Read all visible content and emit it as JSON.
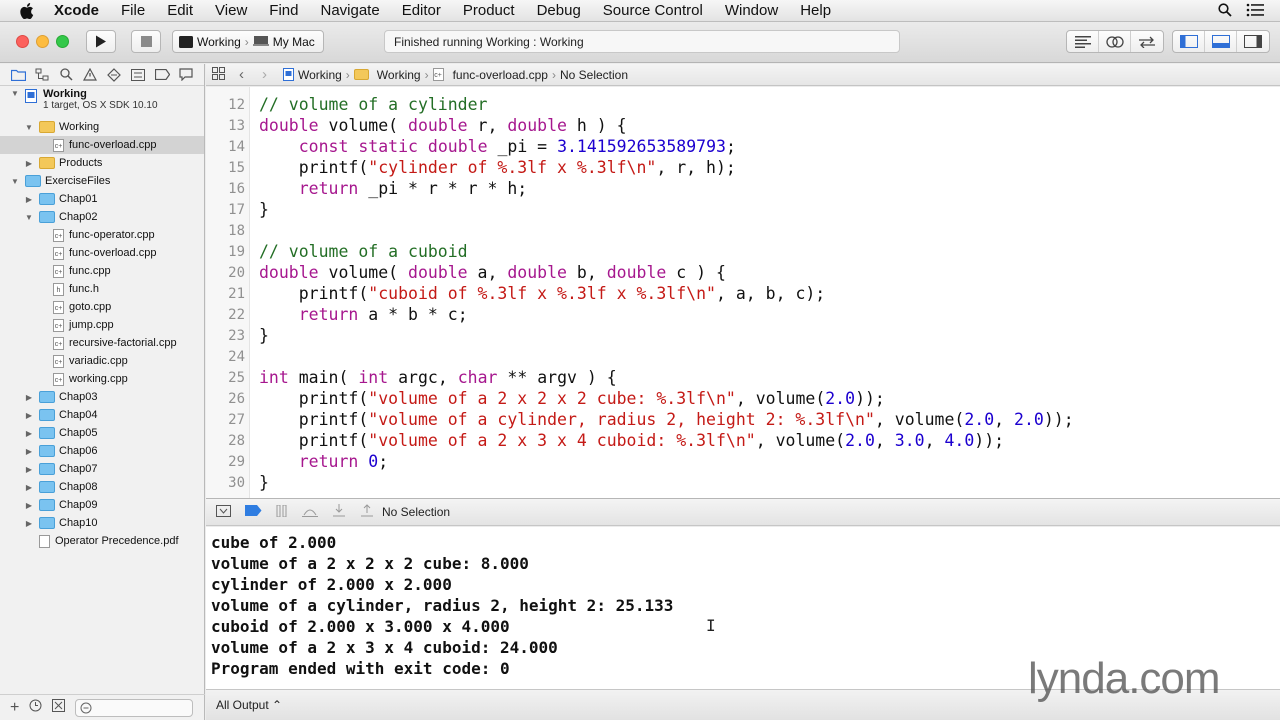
{
  "menubar": {
    "app_name": "Xcode",
    "items": [
      "File",
      "Edit",
      "View",
      "Find",
      "Navigate",
      "Editor",
      "Product",
      "Debug",
      "Source Control",
      "Window",
      "Help"
    ]
  },
  "toolbar": {
    "scheme": "Working",
    "destination": "My Mac",
    "activity_status": "Finished running Working : Working"
  },
  "navigator": {
    "project": {
      "name": "Working",
      "subtitle": "1 target, OS X SDK 10.10"
    },
    "items": [
      {
        "label": "Working",
        "kind": "folder-yellow",
        "expanded": true,
        "level": 1
      },
      {
        "label": "func-overload.cpp",
        "kind": "cpp",
        "level": 2,
        "selected": true
      },
      {
        "label": "Products",
        "kind": "folder-yellow",
        "expanded": false,
        "level": 1
      },
      {
        "label": "ExerciseFiles",
        "kind": "folder-blue",
        "expanded": true,
        "level": 0
      },
      {
        "label": "Chap01",
        "kind": "folder-blue",
        "expanded": false,
        "level": 1
      },
      {
        "label": "Chap02",
        "kind": "folder-blue",
        "expanded": true,
        "level": 1
      },
      {
        "label": "func-operator.cpp",
        "kind": "cpp",
        "level": 2
      },
      {
        "label": "func-overload.cpp",
        "kind": "cpp",
        "level": 2
      },
      {
        "label": "func.cpp",
        "kind": "cpp",
        "level": 2
      },
      {
        "label": "func.h",
        "kind": "h",
        "level": 2
      },
      {
        "label": "goto.cpp",
        "kind": "cpp",
        "level": 2
      },
      {
        "label": "jump.cpp",
        "kind": "cpp",
        "level": 2
      },
      {
        "label": "recursive-factorial.cpp",
        "kind": "cpp",
        "level": 2
      },
      {
        "label": "variadic.cpp",
        "kind": "cpp",
        "level": 2
      },
      {
        "label": "working.cpp",
        "kind": "cpp",
        "level": 2
      },
      {
        "label": "Chap03",
        "kind": "folder-blue",
        "expanded": false,
        "level": 1
      },
      {
        "label": "Chap04",
        "kind": "folder-blue",
        "expanded": false,
        "level": 1
      },
      {
        "label": "Chap05",
        "kind": "folder-blue",
        "expanded": false,
        "level": 1
      },
      {
        "label": "Chap06",
        "kind": "folder-blue",
        "expanded": false,
        "level": 1
      },
      {
        "label": "Chap07",
        "kind": "folder-blue",
        "expanded": false,
        "level": 1
      },
      {
        "label": "Chap08",
        "kind": "folder-blue",
        "expanded": false,
        "level": 1
      },
      {
        "label": "Chap09",
        "kind": "folder-blue",
        "expanded": false,
        "level": 1
      },
      {
        "label": "Chap10",
        "kind": "folder-blue",
        "expanded": false,
        "level": 1
      },
      {
        "label": "Operator Precedence.pdf",
        "kind": "pdf",
        "level": 1
      }
    ]
  },
  "jumpbar": {
    "crumbs": [
      "Working",
      "Working",
      "func-overload.cpp",
      "No Selection"
    ]
  },
  "editor": {
    "first_line": 12,
    "lines": [
      [
        [
          "cm",
          "// volume of a cylinder"
        ]
      ],
      [
        [
          "kw",
          "double"
        ],
        [
          "",
          " volume( "
        ],
        [
          "kw",
          "double"
        ],
        [
          "",
          " r, "
        ],
        [
          "kw",
          "double"
        ],
        [
          "",
          " h ) {"
        ]
      ],
      [
        [
          "",
          "    "
        ],
        [
          "kw",
          "const"
        ],
        [
          "",
          " "
        ],
        [
          "kw",
          "static"
        ],
        [
          "",
          " "
        ],
        [
          "kw",
          "double"
        ],
        [
          "",
          " _pi = "
        ],
        [
          "nu",
          "3.141592653589793"
        ],
        [
          "",
          ";"
        ]
      ],
      [
        [
          "",
          "    printf("
        ],
        [
          "st",
          "\"cylinder of %.3lf x %.3lf\\n\""
        ],
        [
          "",
          ", r, h);"
        ]
      ],
      [
        [
          "",
          "    "
        ],
        [
          "kw",
          "return"
        ],
        [
          "",
          " _pi * r * r * h;"
        ]
      ],
      [
        [
          "",
          "}"
        ]
      ],
      [
        [
          "",
          ""
        ]
      ],
      [
        [
          "cm",
          "// volume of a cuboid"
        ]
      ],
      [
        [
          "kw",
          "double"
        ],
        [
          "",
          " volume( "
        ],
        [
          "kw",
          "double"
        ],
        [
          "",
          " a, "
        ],
        [
          "kw",
          "double"
        ],
        [
          "",
          " b, "
        ],
        [
          "kw",
          "double"
        ],
        [
          "",
          " c ) {"
        ]
      ],
      [
        [
          "",
          "    printf("
        ],
        [
          "st",
          "\"cuboid of %.3lf x %.3lf x %.3lf\\n\""
        ],
        [
          "",
          ", a, b, c);"
        ]
      ],
      [
        [
          "",
          "    "
        ],
        [
          "kw",
          "return"
        ],
        [
          "",
          " a * b * c;"
        ]
      ],
      [
        [
          "",
          "}"
        ]
      ],
      [
        [
          "",
          ""
        ]
      ],
      [
        [
          "kw",
          "int"
        ],
        [
          "",
          " main( "
        ],
        [
          "kw",
          "int"
        ],
        [
          "",
          " argc, "
        ],
        [
          "kw",
          "char"
        ],
        [
          "",
          " ** argv ) {"
        ]
      ],
      [
        [
          "",
          "    printf("
        ],
        [
          "st",
          "\"volume of a 2 x 2 x 2 cube: %.3lf\\n\""
        ],
        [
          "",
          ", volume("
        ],
        [
          "nu",
          "2.0"
        ],
        [
          "",
          "));"
        ]
      ],
      [
        [
          "",
          "    printf("
        ],
        [
          "st",
          "\"volume of a cylinder, radius 2, height 2: %.3lf\\n\""
        ],
        [
          "",
          ", volume("
        ],
        [
          "nu",
          "2.0"
        ],
        [
          "",
          ", "
        ],
        [
          "nu",
          "2.0"
        ],
        [
          "",
          "));"
        ]
      ],
      [
        [
          "",
          "    printf("
        ],
        [
          "st",
          "\"volume of a 2 x 3 x 4 cuboid: %.3lf\\n\""
        ],
        [
          "",
          ", volume("
        ],
        [
          "nu",
          "2.0"
        ],
        [
          "",
          ", "
        ],
        [
          "nu",
          "3.0"
        ],
        [
          "",
          ", "
        ],
        [
          "nu",
          "4.0"
        ],
        [
          "",
          "));"
        ]
      ],
      [
        [
          "",
          "    "
        ],
        [
          "kw",
          "return"
        ],
        [
          "",
          " "
        ],
        [
          "nu",
          "0"
        ],
        [
          "",
          ";"
        ]
      ],
      [
        [
          "",
          "}"
        ]
      ]
    ]
  },
  "debugbar": {
    "selection": "No Selection"
  },
  "console": {
    "lines": [
      "cube of 2.000",
      "volume of a 2 x 2 x 2 cube: 8.000",
      "cylinder of 2.000 x 2.000",
      "volume of a cylinder, radius 2, height 2: 25.133",
      "cuboid of 2.000 x 3.000 x 4.000",
      "volume of a 2 x 3 x 4 cuboid: 24.000",
      "Program ended with exit code: 0"
    ],
    "filter": "All Output ⌃"
  },
  "watermark": "lynda.com"
}
